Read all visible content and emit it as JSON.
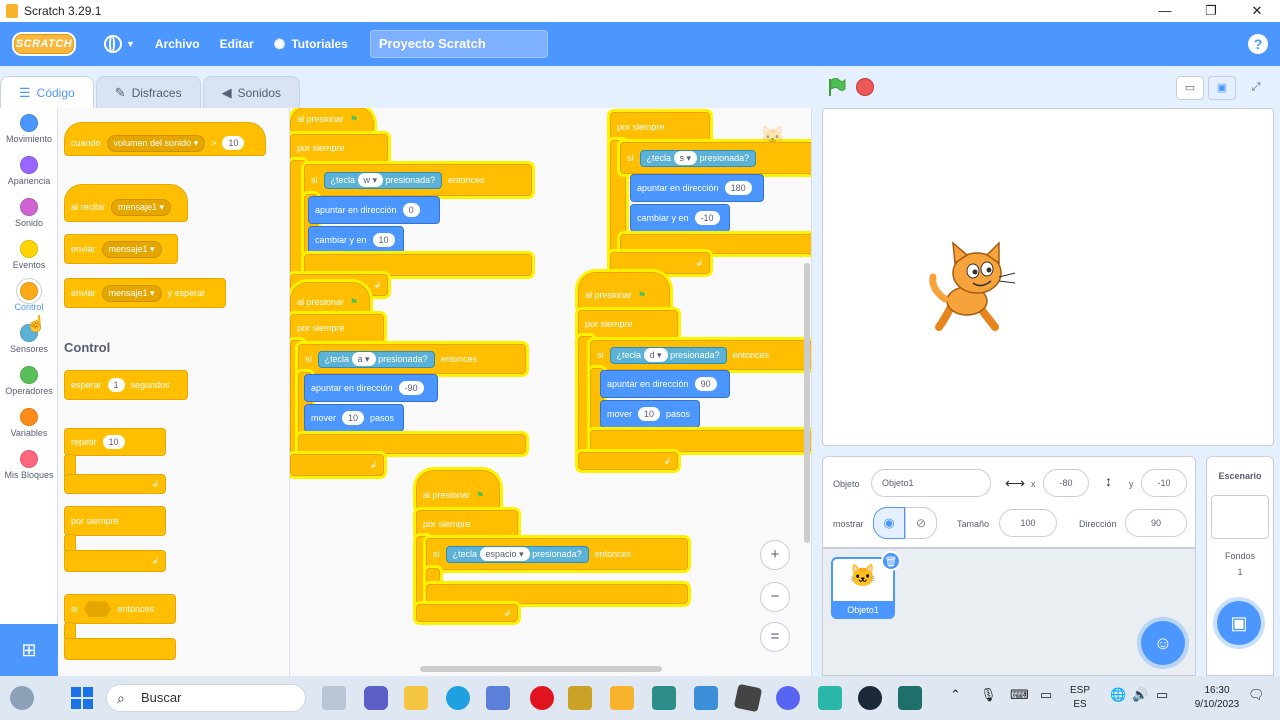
{
  "window": {
    "title": "Scratch 3.29.1",
    "minimize": "—",
    "maximize": "❐",
    "close": "✕"
  },
  "menubar": {
    "logo": "SCRATCH",
    "file": "Archivo",
    "edit": "Editar",
    "tutorials": "Tutoriales",
    "project_name": "Proyecto Scratch",
    "help": "?"
  },
  "tabs": [
    {
      "label": "Código"
    },
    {
      "label": "Disfraces"
    },
    {
      "label": "Sonidos"
    }
  ],
  "categories": [
    {
      "label": "Movimiento",
      "color": "#4c97ff"
    },
    {
      "label": "Apariencia",
      "color": "#9966ff"
    },
    {
      "label": "Sonido",
      "color": "#cf63cf"
    },
    {
      "label": "Eventos",
      "color": "#ffd500"
    },
    {
      "label": "Control",
      "color": "#ffab19"
    },
    {
      "label": "Sensores",
      "color": "#5cb1d6"
    },
    {
      "label": "Operadores",
      "color": "#59c059"
    },
    {
      "label": "Variables",
      "color": "#ff8c1a"
    },
    {
      "label": "Mis Bloques",
      "color": "#ff6680"
    }
  ],
  "palette": {
    "when_loudness": {
      "when": "cuando",
      "what": "volumen del sonido",
      "op": ">",
      "value": "10"
    },
    "when_receive": {
      "label": "al recibir",
      "msg": "mensaje1"
    },
    "broadcast": {
      "label": "enviar",
      "msg": "mensaje1"
    },
    "broadcast_wait": {
      "label": "enviar",
      "msg": "mensaje1",
      "suffix": "y esperar"
    },
    "heading": "Control",
    "wait": {
      "label": "esperar",
      "value": "1",
      "suffix": "segundos"
    },
    "repeat": {
      "label": "repetir",
      "value": "10"
    },
    "forever": {
      "label": "por siempre"
    },
    "if": {
      "label": "si",
      "suffix": "entonces"
    }
  },
  "scripts": {
    "common": {
      "flag_hat": "al presionar",
      "forever": "por siempre",
      "if": "si",
      "key": "¿tecla",
      "pressed": "presionada?",
      "then": "entonces",
      "point": "apuntar en dirección",
      "change_y": "cambiar y en",
      "move": "mover",
      "steps": "pasos"
    },
    "script_w": {
      "key": "w",
      "direction": "0",
      "change": "10"
    },
    "script_s": {
      "key": "s",
      "direction": "180",
      "change": "-10"
    },
    "script_a": {
      "key": "a",
      "direction": "-90",
      "steps": "10"
    },
    "script_d": {
      "key": "d",
      "direction": "90",
      "steps": "10"
    },
    "script_space": {
      "key": "espacio"
    }
  },
  "zoom": {
    "in": "+",
    "out": "−",
    "reset": "="
  },
  "sprite_info": {
    "object_label": "Objeto",
    "object_name": "Objeto1",
    "x_label": "x",
    "x_value": "-80",
    "y_label": "y",
    "y_value": "-10",
    "show_label": "mostrar",
    "size_label": "Tamaño",
    "size_value": "100",
    "direction_label": "Dirección",
    "direction_value": "90"
  },
  "sprite_list": {
    "sprite_name": "Objeto1"
  },
  "stage_panel": {
    "title": "Escenario",
    "backdrops_label": "Fondos",
    "backdrops_count": "1"
  },
  "taskbar": {
    "search": "Buscar",
    "lang_top": "ESP",
    "lang_bottom": "ES",
    "time": "16:30",
    "date": "9/10/2023"
  }
}
